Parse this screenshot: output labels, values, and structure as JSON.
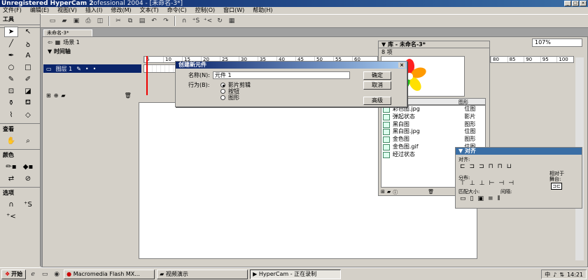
{
  "title": {
    "text": "Unregistered HyperCam 2",
    "subtitle": "ofessional 2004 - [未命名-3*]"
  },
  "menu": [
    "文件(F)",
    "编辑(E)",
    "视图(V)",
    "插入(I)",
    "修改(M)",
    "文本(T)",
    "命令(C)",
    "控制(O)",
    "窗口(W)",
    "帮助(H)"
  ],
  "tools": {
    "header": "工具",
    "view_label": "查看",
    "color_label": "颜色",
    "options_label": "选项"
  },
  "document": {
    "tab": "未命名-3*",
    "scene": "场景 1",
    "zoom": "107%",
    "timeline_label": "时间轴",
    "layer_name": "图层 1",
    "ruler_ticks": [
      "5",
      "10",
      "15",
      "20",
      "25",
      "30",
      "35",
      "40",
      "45",
      "50",
      "55",
      "60"
    ],
    "ruler_ticks_right": [
      "80",
      "85",
      "90",
      "95",
      "100"
    ]
  },
  "dialog": {
    "title": "创建新元件",
    "name_label": "名称(N):",
    "name_value": "元件 1",
    "behavior_label": "行为(B):",
    "options": [
      "影片剪辑",
      "按钮",
      "图形"
    ],
    "selected": "影片剪辑",
    "ok": "确定",
    "cancel": "取消",
    "advanced": "高级"
  },
  "library": {
    "header": "库 - 未命名-3*",
    "count": "8 项",
    "col_name": "名称",
    "col_type": "类型",
    "items": [
      {
        "name": "彩色图.jpg",
        "type": "位图"
      },
      {
        "name": "弹起状态",
        "type": "影片"
      },
      {
        "name": "黑白图",
        "type": "图形"
      },
      {
        "name": "黑白图.jpg",
        "type": "位图"
      },
      {
        "name": "金色图",
        "type": "图形"
      },
      {
        "name": "金色图.gif",
        "type": "位图"
      },
      {
        "name": "经过状态",
        "type": "图形"
      }
    ],
    "type_top": "图形"
  },
  "align": {
    "header": "对齐",
    "align_label": "对齐:",
    "distribute_label": "分布:",
    "match_label": "匹配大小:",
    "space_label": "间隔:",
    "to_stage_label": "相对于\n舞台:",
    "to_stage": "相对于",
    "to_stage2": "舞台:"
  },
  "taskbar": {
    "start": "开始",
    "tasks": [
      "Macromedia Flash MX...",
      "视频演示",
      "HyperCam - 正在录制"
    ],
    "clock": "14:21"
  },
  "colors": {
    "title_bg": "#0a246a",
    "accent": "#3a6ea5"
  }
}
